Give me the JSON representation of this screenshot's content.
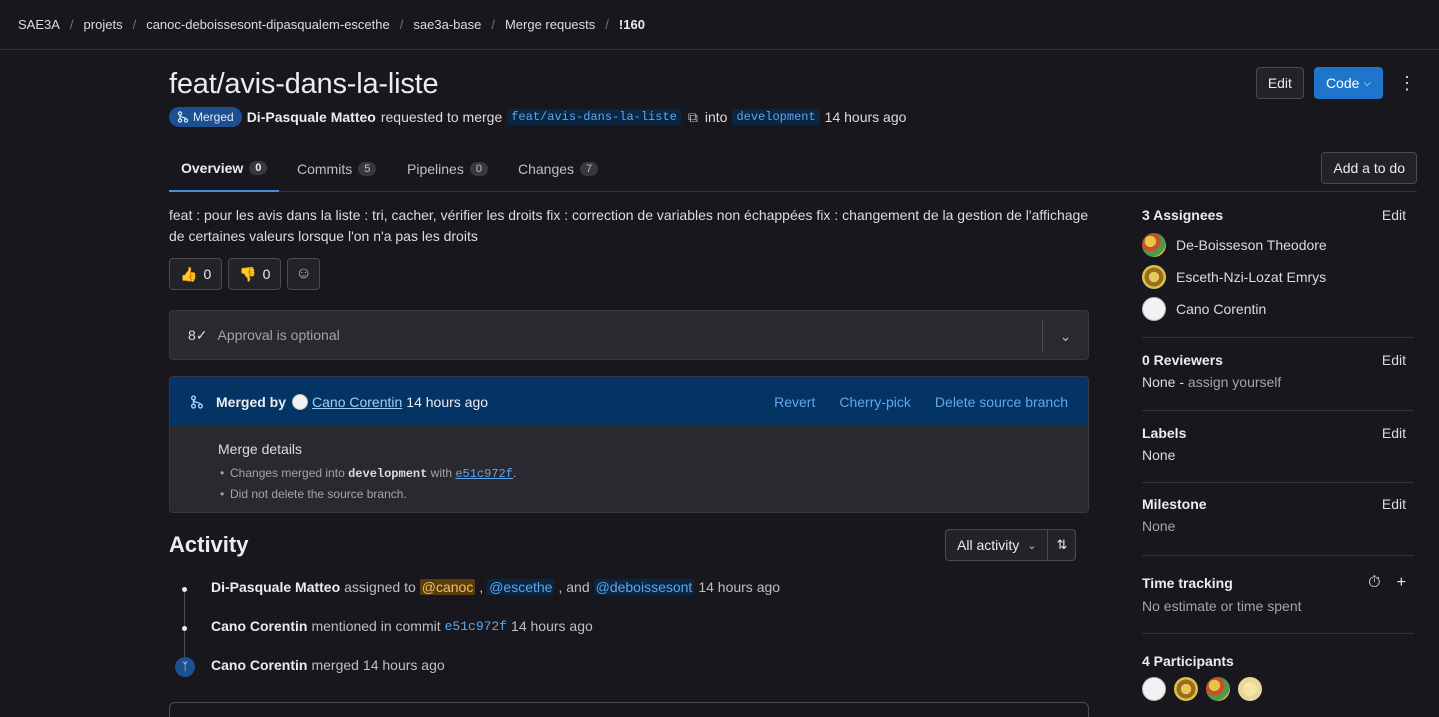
{
  "breadcrumb": [
    "SAE3A",
    "projets",
    "canoc-deboissesont-dipasqualem-escethe",
    "sae3a-base",
    "Merge requests",
    "!160"
  ],
  "title": "feat/avis-dans-la-liste",
  "header": {
    "edit_label": "Edit",
    "code_label": "Code"
  },
  "meta": {
    "status": "Merged",
    "author": "Di-Pasquale Matteo",
    "requested_text": "requested to merge",
    "source_branch": "feat/avis-dans-la-liste",
    "into_text": "into",
    "target_branch": "development",
    "time": "14 hours ago"
  },
  "tabs": [
    {
      "label": "Overview",
      "count": "0"
    },
    {
      "label": "Commits",
      "count": "5"
    },
    {
      "label": "Pipelines",
      "count": "0"
    },
    {
      "label": "Changes",
      "count": "7"
    }
  ],
  "todo_label": "Add a to do",
  "description": "feat : pour les avis dans la liste : tri, cacher, vérifier les droits fix : correction de variables non échappées fix : changement de la gestion de l'affichage de certaines valeurs lorsque l'on n'a pas les droits",
  "reactions": {
    "thumbs_up": "0",
    "thumbs_down": "0"
  },
  "approval": {
    "text": "Approval is optional"
  },
  "merged": {
    "by_label": "Merged by",
    "user": "Cano Corentin",
    "time": "14 hours ago",
    "revert": "Revert",
    "cherry_pick": "Cherry-pick",
    "delete_branch": "Delete source branch",
    "details_title": "Merge details",
    "detail1_pre": "Changes merged into",
    "detail1_branch": "development",
    "detail1_mid": "with",
    "detail1_commit": "e51c972f",
    "detail1_end": ".",
    "detail2": "Did not delete the source branch."
  },
  "activity": {
    "title": "Activity",
    "filter": "All activity",
    "items": [
      {
        "user": "Di-Pasquale Matteo",
        "text": "assigned to",
        "m1": "@canoc",
        "m2": "@escethe",
        "and": ", and",
        "m3": "@deboissesont",
        "time": "14 hours ago"
      },
      {
        "user": "Cano Corentin",
        "text": "mentioned in commit",
        "commit": "e51c972f",
        "time": "14 hours ago"
      },
      {
        "user": "Cano Corentin",
        "text": "merged",
        "time": "14 hours ago"
      }
    ]
  },
  "sidebar": {
    "edit": "Edit",
    "assignees_title": "3 Assignees",
    "assignees": [
      "De-Boisseson Theodore",
      "Esceth-Nzi-Lozat Emrys",
      "Cano Corentin"
    ],
    "reviewers_title": "0 Reviewers",
    "reviewers_none": "None -",
    "reviewers_assign": "assign yourself",
    "labels_title": "Labels",
    "labels_value": "None",
    "milestone_title": "Milestone",
    "milestone_value": "None",
    "time_title": "Time tracking",
    "time_value": "No estimate or time spent",
    "participants_title": "4 Participants"
  }
}
